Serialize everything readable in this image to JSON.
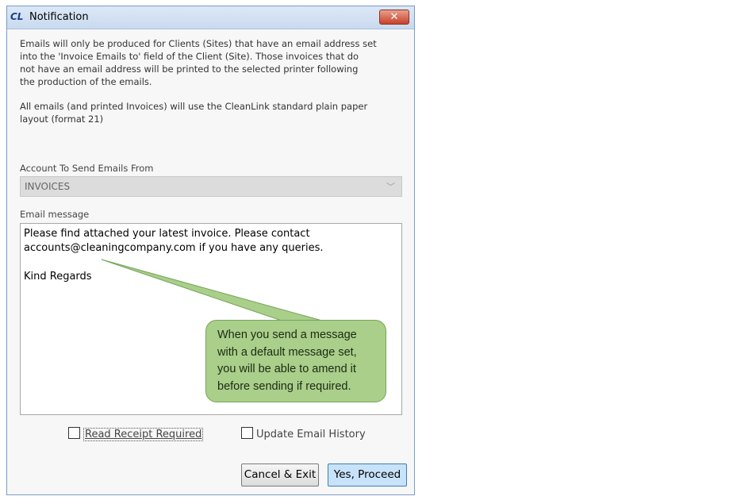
{
  "window": {
    "icon_text": "CL",
    "title": "Notification",
    "close_symbol": "✕"
  },
  "info": {
    "paragraph1": "Emails will only be produced for Clients (Sites) that have an email address set\ninto the 'Invoice Emails to' field of the Client (Site). Those invoices that do\nnot have an email address will be printed to the selected printer following\nthe production of the emails.",
    "paragraph2": "All emails (and printed Invoices) will use the CleanLink standard plain paper\nlayout (format 21)"
  },
  "account": {
    "label": "Account To Send Emails From",
    "value": "INVOICES",
    "chevron": "﹀"
  },
  "email": {
    "label": "Email message",
    "value": "Please find attached your latest invoice. Please contact\naccounts@cleaningcompany.com if you have any queries.\n\nKind Regards"
  },
  "options": {
    "read_receipt_label": "Read Receipt Required",
    "read_receipt_checked": false,
    "update_history_label": "Update Email History",
    "update_history_checked": false
  },
  "buttons": {
    "cancel_label": "Cancel & Exit",
    "proceed_label": "Yes, Proceed"
  },
  "callout": {
    "text": "When you send a message with a default message set, you will be able to amend it before sending if required."
  },
  "colors": {
    "callout_fill": "#a9cf8a",
    "proceed_fill": "#c8e2fa",
    "titlebar": "#dce8f6"
  }
}
